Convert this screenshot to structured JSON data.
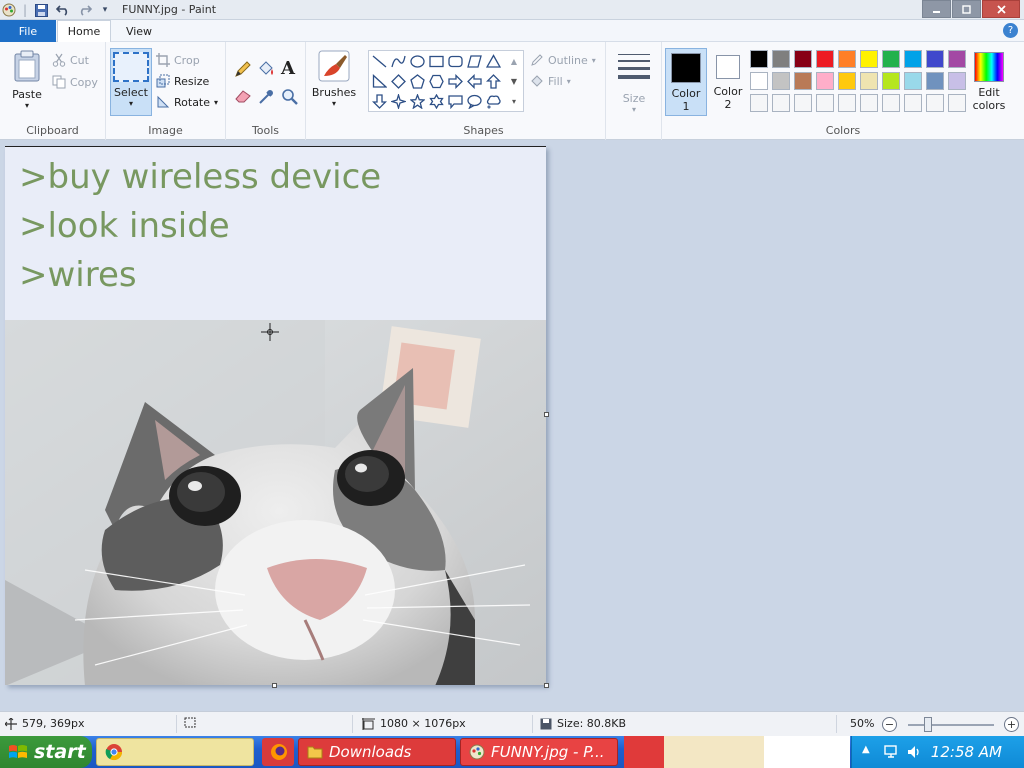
{
  "app": {
    "title": "FUNNY.jpg - Paint"
  },
  "tabs": {
    "file": "File",
    "home": "Home",
    "view": "View"
  },
  "ribbon": {
    "clipboard": {
      "label": "Clipboard",
      "paste": "Paste",
      "cut": "Cut",
      "copy": "Copy"
    },
    "image": {
      "label": "Image",
      "select": "Select",
      "crop": "Crop",
      "resize": "Resize",
      "rotate": "Rotate"
    },
    "tools": {
      "label": "Tools"
    },
    "brushes": {
      "label": "Brushes"
    },
    "shapes": {
      "label": "Shapes",
      "outline": "Outline",
      "fill": "Fill"
    },
    "size": {
      "label": "Size"
    },
    "colors": {
      "label": "Colors",
      "color1_line1": "Color",
      "color1_line2": "1",
      "color2_line1": "Color",
      "color2_line2": "2",
      "edit_line1": "Edit",
      "edit_line2": "colors",
      "color1": "#000000",
      "color2": "#ffffff",
      "palette_row1": [
        "#000000",
        "#7f7f7f",
        "#880015",
        "#ed1c24",
        "#ff7f27",
        "#fff200",
        "#22b14c",
        "#00a2e8",
        "#3f48cc",
        "#a349a4"
      ],
      "palette_row2": [
        "#ffffff",
        "#c3c3c3",
        "#b97a57",
        "#ffaec9",
        "#ffc90e",
        "#efe4b0",
        "#b5e61d",
        "#99d9ea",
        "#7092be",
        "#c8bfe7"
      ],
      "palette_row3": [
        "#f5f6f8",
        "#f5f6f8",
        "#f5f6f8",
        "#f5f6f8",
        "#f5f6f8",
        "#f5f6f8",
        "#f5f6f8",
        "#f5f6f8",
        "#f5f6f8",
        "#f5f6f8"
      ]
    }
  },
  "canvas": {
    "greentext": [
      ">buy wireless device",
      ">look inside",
      ">wires"
    ]
  },
  "status": {
    "cursor_pos": "579, 369px",
    "dimensions": "1080 × 1076px",
    "size": "Size: 80.8KB",
    "zoom": "50%"
  },
  "taskbar": {
    "start": "start",
    "downloads": "Downloads",
    "paint": "FUNNY.jpg - P...",
    "clock": "12:58 AM"
  }
}
